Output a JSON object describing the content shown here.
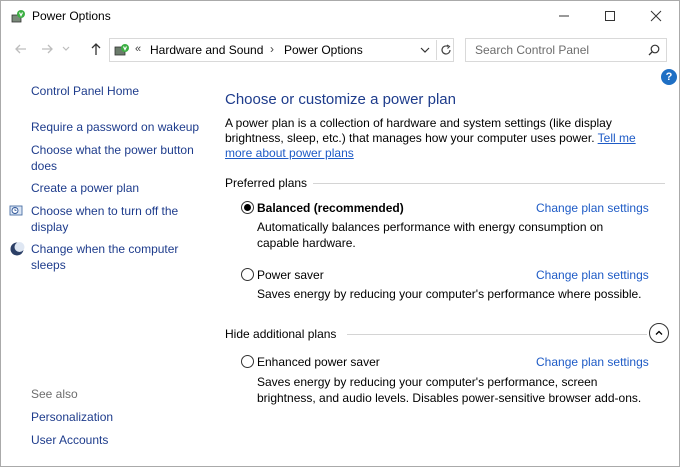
{
  "window": {
    "title": "Power Options"
  },
  "address": {
    "breadcrumbs": [
      "Hardware and Sound",
      "Power Options"
    ]
  },
  "search": {
    "placeholder": "Search Control Panel"
  },
  "help": {
    "label": "?"
  },
  "sidebar": {
    "home": "Control Panel Home",
    "items": [
      "Require a password on wakeup",
      "Choose what the power button does",
      "Create a power plan",
      "Choose when to turn off the display",
      "Change when the computer sleeps"
    ],
    "see_also_label": "See also",
    "see_also": [
      "Personalization",
      "User Accounts"
    ]
  },
  "main": {
    "title": "Choose or customize a power plan",
    "description": "A power plan is a collection of hardware and system settings (like display brightness, sleep, etc.) that manages how your computer uses power.",
    "learn_more": "Tell me more about power plans",
    "preferred_heading": "Preferred plans",
    "additional_heading": "Hide additional plans",
    "change_settings_label": "Change plan settings",
    "plans": [
      {
        "name": "Balanced (recommended)",
        "selected": true,
        "description": "Automatically balances performance with energy consumption on capable hardware."
      },
      {
        "name": "Power saver",
        "selected": false,
        "description": "Saves energy by reducing your computer's performance where possible."
      },
      {
        "name": "Enhanced power saver",
        "selected": false,
        "description": "Saves energy by reducing your computer's performance, screen brightness, and audio levels. Disables power-sensitive browser add-ons."
      }
    ]
  },
  "colors": {
    "link": "#1e3c8c",
    "hyperlink": "#1e5bc6",
    "help_badge": "#1e6fc4"
  }
}
